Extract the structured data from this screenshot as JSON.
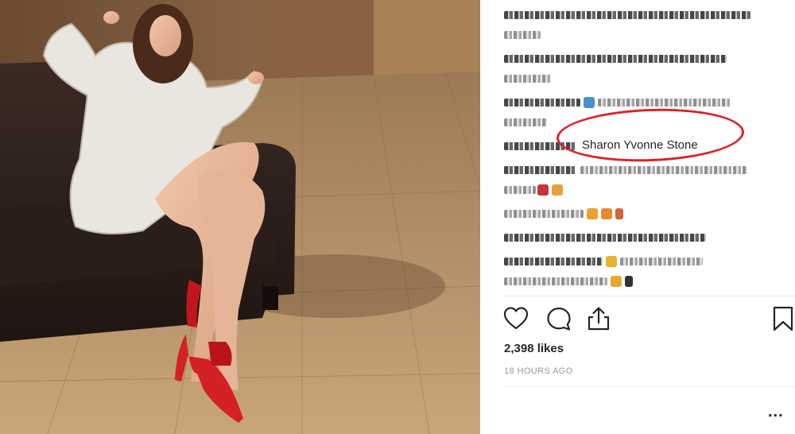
{
  "post": {
    "highlighted_comment": "Sharon Yvonne Stone",
    "likes": "2,398 likes",
    "timestamp": "18 HOURS AGO",
    "more_label": "..."
  },
  "icons": {
    "like": "heart-icon",
    "comment": "comment-bubble-icon",
    "share": "share-upload-icon",
    "save": "bookmark-icon",
    "more": "more-options-icon"
  },
  "colors": {
    "highlight_ellipse": "#d9242b",
    "text": "#262626",
    "muted": "#999999"
  }
}
